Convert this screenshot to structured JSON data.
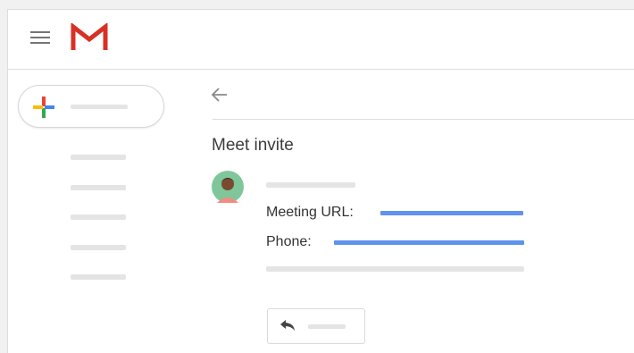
{
  "header": {
    "menu_icon": "hamburger-menu-icon",
    "logo_icon": "gmail-m-logo"
  },
  "sidebar": {
    "compose_icon": "multicolor-plus-icon",
    "nav_item_count": 5
  },
  "message": {
    "back_icon": "back-arrow-icon",
    "subject": "Meet invite",
    "meeting_url_label": "Meeting URL:",
    "phone_label": "Phone:",
    "reply_icon": "reply-arrow-icon"
  },
  "colors": {
    "logo_red": "#d93025",
    "link_blue": "#5f93ec",
    "placeholder_gray": "#e4e4e4",
    "plus_blue": "#4285f4",
    "plus_red": "#ea4335",
    "plus_yellow": "#fbbc04",
    "plus_green": "#34a853",
    "avatar_green": "#7fc79a"
  }
}
